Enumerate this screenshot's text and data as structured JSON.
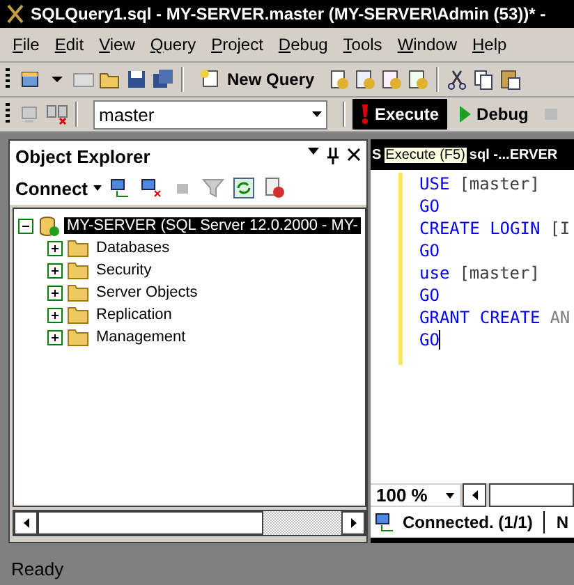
{
  "window": {
    "title": "SQLQuery1.sql - MY-SERVER.master (MY-SERVER\\Admin (53))* -"
  },
  "menu": [
    "File",
    "Edit",
    "View",
    "Query",
    "Project",
    "Debug",
    "Tools",
    "Window",
    "Help"
  ],
  "toolbar": {
    "new_query": "New Query"
  },
  "query_toolbar": {
    "database": "master",
    "execute": {
      "label": "Execute",
      "hovered": true
    },
    "debug": "Debug"
  },
  "object_explorer": {
    "title": "Object Explorer",
    "connect": "Connect",
    "tree": [
      {
        "label": "MY-SERVER (SQL Server 12.0.2000 - MY-",
        "selected": true,
        "expanded": true,
        "children": [
          {
            "label": "Databases",
            "selected": false,
            "expanded": false
          },
          {
            "label": "Security",
            "selected": false,
            "expanded": false
          },
          {
            "label": "Server Objects",
            "selected": false,
            "expanded": false
          },
          {
            "label": "Replication",
            "selected": false,
            "expanded": false
          },
          {
            "label": "Management",
            "selected": false,
            "expanded": false
          }
        ]
      }
    ]
  },
  "editor": {
    "tab_start": "S",
    "tab_end": "sql -...ERVER",
    "tooltip": "Execute (F5)",
    "lines": [
      {
        "caret": false,
        "tokens": [
          {
            "kind": "keyword",
            "text": "USE"
          },
          {
            "kind": "text",
            "text": "[master]"
          }
        ]
      },
      {
        "caret": false,
        "tokens": [
          {
            "kind": "keyword",
            "text": "GO"
          }
        ]
      },
      {
        "caret": false,
        "tokens": [
          {
            "kind": "keyword",
            "text": "CREATE LOGIN"
          },
          {
            "kind": "text",
            "text": "[I"
          }
        ]
      },
      {
        "caret": false,
        "tokens": [
          {
            "kind": "keyword",
            "text": "GO"
          }
        ]
      },
      {
        "caret": false,
        "tokens": [
          {
            "kind": "keyword",
            "text": "use"
          },
          {
            "kind": "text",
            "text": "[master]"
          }
        ]
      },
      {
        "caret": false,
        "tokens": [
          {
            "kind": "keyword",
            "text": "GO"
          }
        ]
      },
      {
        "caret": false,
        "tokens": [
          {
            "kind": "keyword",
            "text": "GRANT CREATE"
          },
          {
            "kind": "faded",
            "text": "AN"
          }
        ]
      },
      {
        "caret": true,
        "tokens": [
          {
            "kind": "keyword",
            "text": "GO"
          }
        ]
      }
    ],
    "zoom": "100 %",
    "connection": "Connected. (1/1)",
    "next_status": "N"
  },
  "status_bar": "Ready"
}
